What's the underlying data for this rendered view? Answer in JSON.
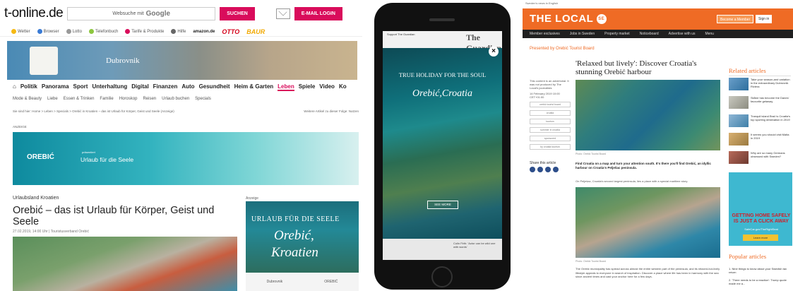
{
  "tonline": {
    "logo": "t-online.de",
    "search_placeholder": "Websuche mit",
    "search_brand": "Google",
    "search_button": "SUCHEN",
    "email_button": "E-MAIL LOGIN",
    "services": [
      "Wetter",
      "Browser",
      "Lotto",
      "Telefonbuch",
      "Tarife & Produkte",
      "Hilfe"
    ],
    "shop_amazon": "amazon.de",
    "shop_otto": "OTTO",
    "shop_baur": "BAUR",
    "hero_text": "Dubrovnik",
    "nav": [
      "Politik",
      "Panorama",
      "Sport",
      "Unterhaltung",
      "Digital",
      "Finanzen",
      "Auto",
      "Gesundheit",
      "Heim & Garten",
      "Leben",
      "Spiele",
      "Video",
      "Ko"
    ],
    "nav_active": "Leben",
    "subnav": [
      "Mode & Beauty",
      "Liebe",
      "Essen & Trinken",
      "Familie",
      "Horoskop",
      "Reisen",
      "Urlaub buchen",
      "Specials"
    ],
    "breadcrumb": "Sie sind hier: Home > Leben > Specials > Orebić in Kroatien – das ist Urlaub für Körper, Geist und Seele (Anzeige)",
    "breadcrumb_right": "Weitere Artikel zu dieser Folge: Nutzen",
    "anzeige": "ANZEIGE",
    "banner_small": "präsentiert",
    "banner_logo": "OREBIĆ",
    "banner_text": "Urlaub für die Seele",
    "article_label": "Urlaubsland Kroatien",
    "article_title": "Orebić – das ist Urlaub für Körper, Geist und Seele",
    "article_meta": "27.02.2019, 14:00 Uhr | Touristusverband Orebić",
    "ad_label": "Anzeige",
    "ad_line1": "URLAUB FÜR DIE SEELE",
    "ad_line2": "Orebić,",
    "ad_line3": "Kroatien",
    "ad_footer": [
      "Dubrovnik",
      "OREBIĆ"
    ]
  },
  "phone": {
    "supported_by": "Support The Guardian",
    "masthead": "The Guardian",
    "close": "×",
    "headline": "TRUE HOLIDAY FOR THE SOUL",
    "destination": "Orebić,Croatia",
    "cta": "SEE MORE",
    "bottom_text": "Colin Firth: 'Actor can be wild one with words'"
  },
  "thelocal": {
    "top_bar": "Sweden's news in English",
    "logo": "THE LOCAL",
    "logo_badge": "SE",
    "member_button": "Become a Member",
    "signin_button": "Sign in",
    "subnav": [
      "Member exclusives",
      "Jobs in Sweden",
      "Property market",
      "Noticeboard",
      "Advertise with us",
      "Menu"
    ],
    "presented_by": "Presented by Orebić Tourist Board",
    "headline": "'Relaxed but lively': Discover Croatia's stunning Orebić harbour",
    "sidebar_note": "This content is an advertorial. It was not produced by The Local's journalists",
    "sidebar_date": "14 February 2019 10:00 CET+01:00",
    "tags": [
      "orebić tourist board",
      "croatia",
      "tourism",
      "summer in croatia",
      "sponsored",
      "by croatia tourism"
    ],
    "img1_caption": "Photo: Orebić Tourist Board",
    "share_label": "Share this article",
    "lead": "Find Croatia on a map and turn your attention south. It's there you'll find Orebić, an idyllic harbour on Croatia's Pelješac peninsula.",
    "p1": "On Pelješac, Croatia's second largest peninsula, lies a place with a special maritime story.",
    "img2_caption": "Photo: Orebić Tourist Board",
    "p2": "The Orebić municipality has spread across almost the entire western part of the peninsula, and its relaxed-but-lively lifestyle appeals to everyone in search of inspiration. Discover a place where life has been in harmony with the sea since ancient times and cast your anchor here for a few days.",
    "related_title": "Related articles",
    "related": [
      "Take your season-and variation in the extraordinary Dubrovnik Riviera",
      "Skåne has become the Danes' favourite getaway",
      "Tranquil island Brač is Croatia's top sporting destination in 2019",
      "It seems you should visit Malta in 2019",
      "Why are so many Germans obsessed with Sweden?"
    ],
    "promo_title": "GETTING HOME SAFELY IS JUST A CLICK AWAY",
    "promo_sub": "SafeCar.gov/TheRightSeat",
    "promo_btn": "Learn more",
    "popular_title": "Popular articles",
    "popular": [
      "1. Nine things to know about your Swedish tax return",
      "2. 'There needs to be a reaction': Trump quote made me a..."
    ]
  }
}
